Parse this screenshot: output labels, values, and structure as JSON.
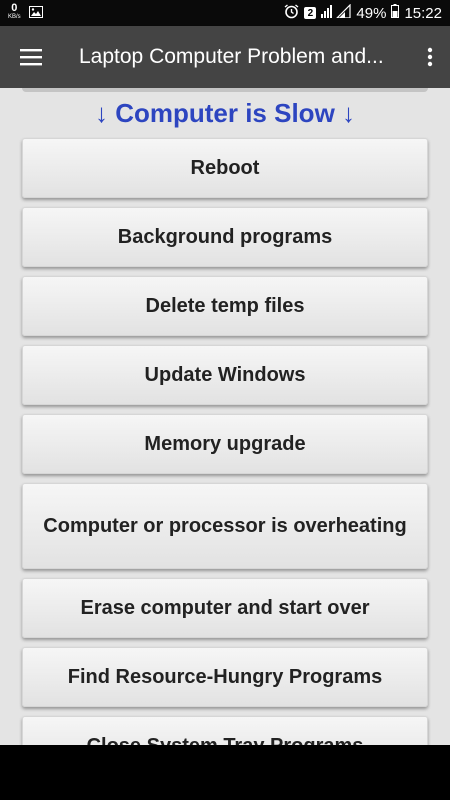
{
  "status_bar": {
    "speed_value": "0",
    "speed_unit": "KB/s",
    "sim_badge": "2",
    "battery": "49%",
    "time": "15:22"
  },
  "app_bar": {
    "title": "Laptop Computer Problem and..."
  },
  "section": {
    "title": "↓ Computer is Slow ↓"
  },
  "items": [
    {
      "label": "Reboot"
    },
    {
      "label": "Background programs"
    },
    {
      "label": "Delete temp files"
    },
    {
      "label": "Update Windows"
    },
    {
      "label": "Memory upgrade"
    },
    {
      "label": "Computer or processor is overheating"
    },
    {
      "label": "Erase computer and start over"
    },
    {
      "label": "Find Resource-Hungry Programs"
    },
    {
      "label": "Close System Tray Programs"
    }
  ],
  "colors": {
    "app_bar": "#444444",
    "section_title": "#2d45c0",
    "background": "#e4e4e4"
  }
}
